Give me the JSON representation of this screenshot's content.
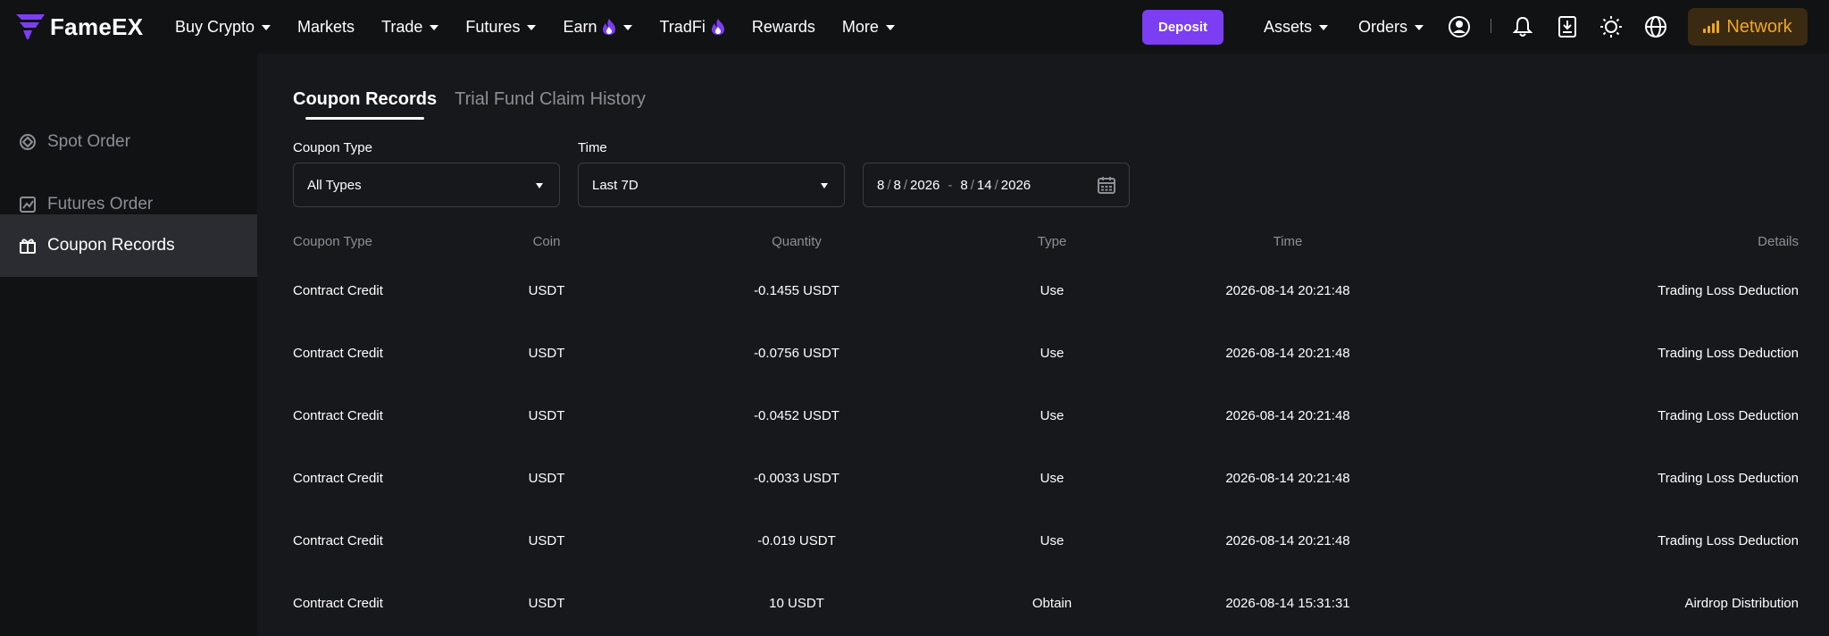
{
  "brand": {
    "name": "FameEX",
    "logo_color": "#7b3ef2"
  },
  "nav": [
    {
      "label": "Buy Crypto",
      "caret": true,
      "fire": false
    },
    {
      "label": "Markets",
      "caret": false,
      "fire": false
    },
    {
      "label": "Trade",
      "caret": true,
      "fire": false
    },
    {
      "label": "Futures",
      "caret": true,
      "fire": false
    },
    {
      "label": "Earn",
      "caret": true,
      "fire": true
    },
    {
      "label": "TradFi",
      "caret": false,
      "fire": true
    },
    {
      "label": "Rewards",
      "caret": false,
      "fire": false
    },
    {
      "label": "More",
      "caret": true,
      "fire": false
    }
  ],
  "header_actions": {
    "deposit_label": "Deposit",
    "assets_label": "Assets",
    "orders_label": "Orders",
    "network_label": "Network",
    "icons": [
      "user-icon",
      "bell-icon",
      "download-icon",
      "sun-icon",
      "globe-icon"
    ]
  },
  "sidebar": {
    "items": [
      {
        "label": "Spot Order",
        "icon": "target-icon",
        "active": false
      },
      {
        "label": "Futures Order",
        "icon": "chart-icon",
        "active": false
      },
      {
        "label": "Coupon Records",
        "icon": "gift-icon",
        "active": true
      }
    ]
  },
  "tabs": [
    {
      "label": "Coupon Records",
      "active": true
    },
    {
      "label": "Trial Fund Claim History",
      "active": false
    }
  ],
  "filters": {
    "coupon_type_label": "Coupon Type",
    "coupon_type_value": "All Types",
    "time_label": "Time",
    "time_value": "Last 7D",
    "date_start": {
      "m": "8",
      "d": "8",
      "y": "2026"
    },
    "date_end": {
      "m": "8",
      "d": "14",
      "y": "2026"
    }
  },
  "table": {
    "headers": {
      "coupon_type": "Coupon Type",
      "coin": "Coin",
      "quantity": "Quantity",
      "type": "Type",
      "time": "Time",
      "details": "Details"
    },
    "rows": [
      {
        "coupon_type": "Contract Credit",
        "coin": "USDT",
        "quantity": "-0.1455 USDT",
        "type": "Use",
        "time": "2026-08-14 20:21:48",
        "details": "Trading Loss Deduction"
      },
      {
        "coupon_type": "Contract Credit",
        "coin": "USDT",
        "quantity": "-0.0756 USDT",
        "type": "Use",
        "time": "2026-08-14 20:21:48",
        "details": "Trading Loss Deduction"
      },
      {
        "coupon_type": "Contract Credit",
        "coin": "USDT",
        "quantity": "-0.0452 USDT",
        "type": "Use",
        "time": "2026-08-14 20:21:48",
        "details": "Trading Loss Deduction"
      },
      {
        "coupon_type": "Contract Credit",
        "coin": "USDT",
        "quantity": "-0.0033 USDT",
        "type": "Use",
        "time": "2026-08-14 20:21:48",
        "details": "Trading Loss Deduction"
      },
      {
        "coupon_type": "Contract Credit",
        "coin": "USDT",
        "quantity": "-0.019 USDT",
        "type": "Use",
        "time": "2026-08-14 20:21:48",
        "details": "Trading Loss Deduction"
      },
      {
        "coupon_type": "Contract Credit",
        "coin": "USDT",
        "quantity": "10 USDT",
        "type": "Obtain",
        "time": "2026-08-14 15:31:31",
        "details": "Airdrop Distribution"
      }
    ]
  },
  "colors": {
    "accent": "#7b3ef2",
    "network": "#f0a623",
    "background": "#17181c",
    "muted": "#8d8f96"
  }
}
